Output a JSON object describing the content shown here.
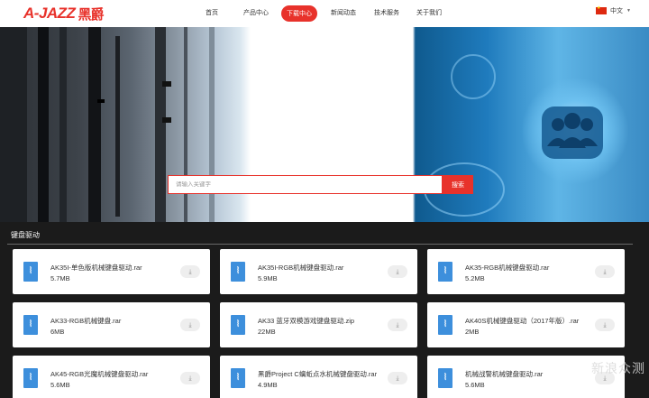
{
  "brand": {
    "logo_latin": "A-JAZZ",
    "logo_cn": "黑爵"
  },
  "nav": {
    "items": [
      {
        "label": "首页",
        "active": false
      },
      {
        "label": "产品中心",
        "active": false
      },
      {
        "label": "下载中心",
        "active": true
      },
      {
        "label": "新闻动态",
        "active": false
      },
      {
        "label": "技术服务",
        "active": false
      },
      {
        "label": "关于我们",
        "active": false
      }
    ],
    "language": "中文"
  },
  "search": {
    "placeholder": "请输入关键字",
    "button_label": "搜索"
  },
  "section": {
    "title": "键盘驱动"
  },
  "downloads": [
    {
      "name": "AK35I-单色版机械键盘驱动.rar",
      "size": "5.7MB"
    },
    {
      "name": "AK35I-RGB机械键盘驱动.rar",
      "size": "5.9MB"
    },
    {
      "name": "AK35-RGB机械键盘驱动.rar",
      "size": "5.2MB"
    },
    {
      "name": "AK33-RGB机械键盘.rar",
      "size": "6MB"
    },
    {
      "name": "AK33 蓝牙双模游戏键盘驱动.zip",
      "size": "22MB"
    },
    {
      "name": "AK40S机械键盘驱动（2017年版）.rar",
      "size": "2MB"
    },
    {
      "name": "AK45-RGB光魔机械键盘驱动.rar",
      "size": "5.6MB"
    },
    {
      "name": "黑爵Project C螭蚯点水机械键盘驱动.rar",
      "size": "4.9MB"
    },
    {
      "name": "机械战警机械键盘驱动.rar",
      "size": "5.6MB"
    }
  ],
  "watermark": "新浪众测",
  "colors": {
    "accent": "#e8322b",
    "file_icon": "#3d8fdc",
    "section_bg": "#1b1b1b"
  },
  "icons": {
    "file": "zip-file-icon",
    "download": "download-icon",
    "flag": "china-flag-icon"
  }
}
